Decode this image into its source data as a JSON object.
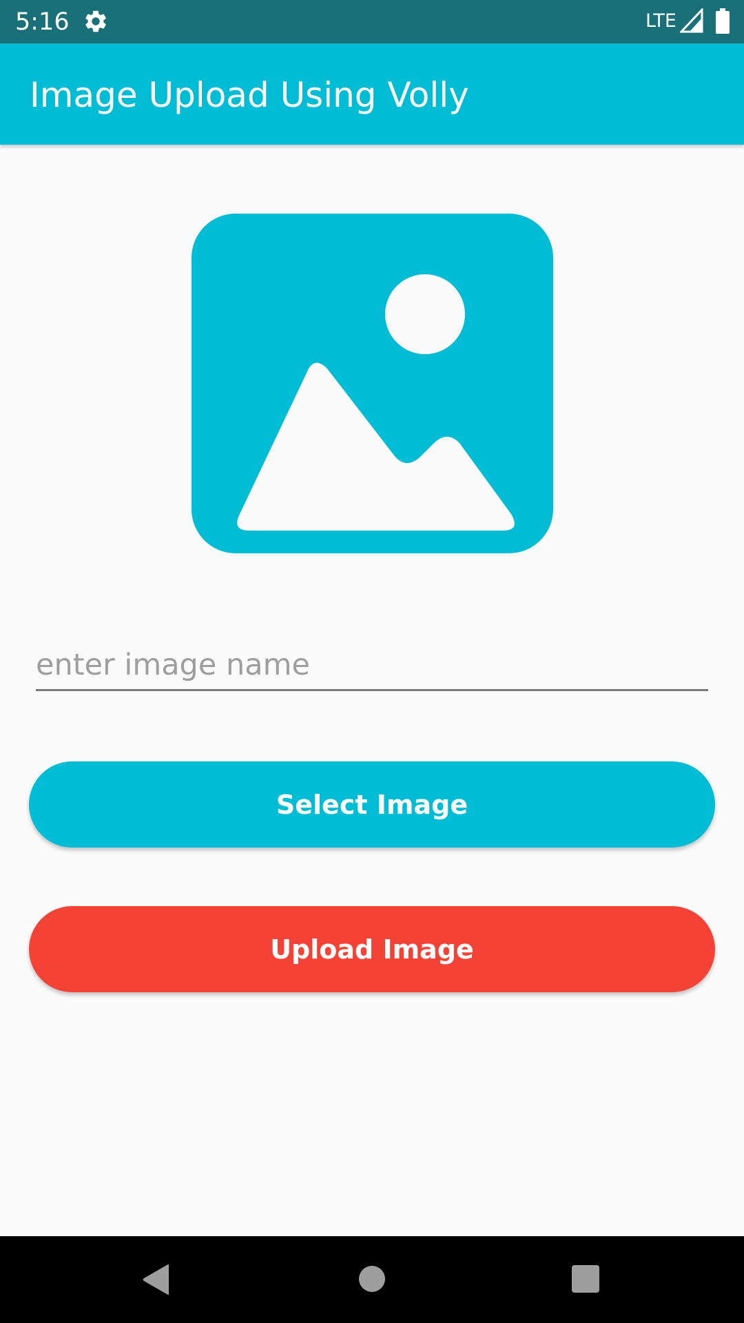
{
  "status_bar": {
    "time": "5:16",
    "network": "LTE",
    "icons": [
      "gear-icon",
      "signal-icon",
      "battery-icon"
    ]
  },
  "app_bar": {
    "title": "Image Upload Using Volly"
  },
  "main": {
    "image_placeholder_icon": "image-icon",
    "name_input": {
      "value": "",
      "placeholder": "enter image name"
    },
    "select_button": {
      "label": "Select Image"
    },
    "upload_button": {
      "label": "Upload Image"
    }
  },
  "nav_bar": {
    "icons": [
      "back-icon",
      "home-icon",
      "recents-icon"
    ]
  },
  "colors": {
    "status_bar": "#1a7079",
    "primary": "#00bcd4",
    "accent_red": "#f44336",
    "background": "#fafafa"
  }
}
